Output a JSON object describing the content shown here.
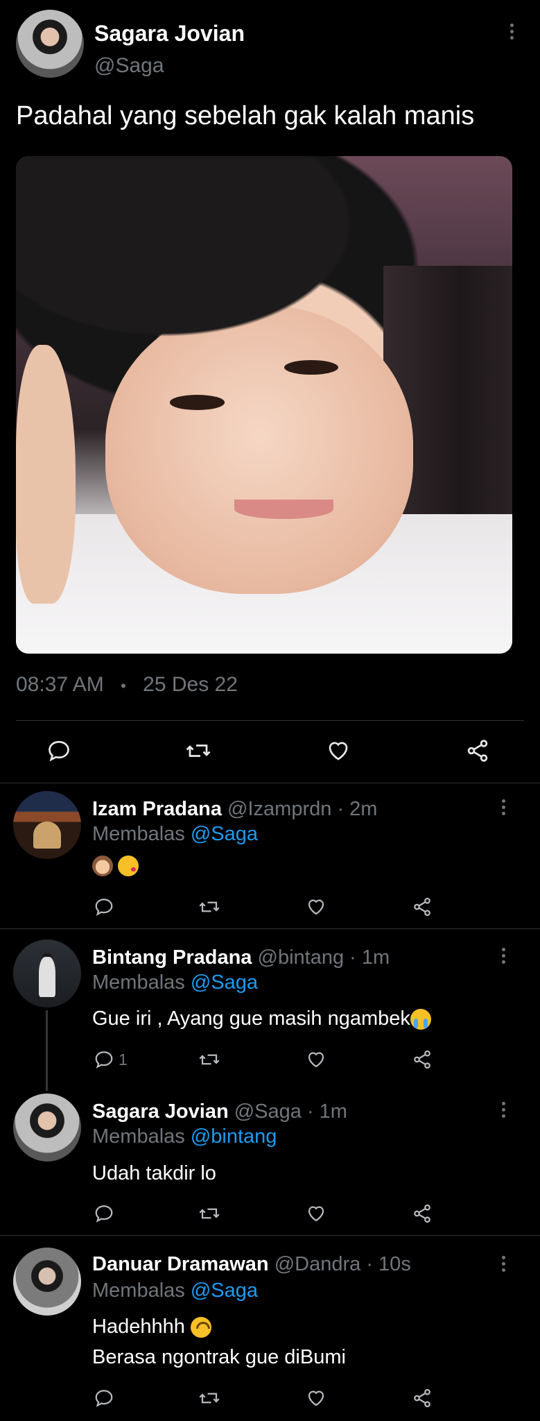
{
  "main_tweet": {
    "display_name": "Sagara Jovian",
    "handle": "@Saga",
    "text": "Padahal yang sebelah gak kalah manis",
    "time": "08:37 AM",
    "separator": "•",
    "date": "25 Des 22"
  },
  "replies": [
    {
      "display_name": "Izam Pradana",
      "handle": "@Izamprdn",
      "time": "· 2m",
      "reply_prefix": "Membalas",
      "reply_to": "@Saga",
      "text": "",
      "emojis": [
        "see-no-evil-monkey",
        "face-blowing-kiss"
      ],
      "reply_count": ""
    },
    {
      "display_name": "Bintang Pradana",
      "handle": "@bintang",
      "time": "· 1m",
      "reply_prefix": "Membalas",
      "reply_to": "@Saga",
      "text": "Gue iri , Ayang gue masih ngambek",
      "emojis": [
        "loudly-crying-face"
      ],
      "reply_count": "1"
    },
    {
      "display_name": "Sagara Jovian",
      "handle": "@Saga",
      "time": "· 1m",
      "reply_prefix": "Membalas",
      "reply_to": "@bintang",
      "text": "Udah takdir lo",
      "emojis": [],
      "reply_count": ""
    },
    {
      "display_name": "Danuar Dramawan",
      "handle": "@Dandra",
      "time": "· 10s",
      "reply_prefix": "Membalas",
      "reply_to": "@Saga",
      "text": "Hadehhhh",
      "text_line2": "Berasa ngontrak gue diBumi",
      "emojis": [
        "upside-down-face"
      ],
      "reply_count": ""
    }
  ],
  "icons": {
    "reply": "reply-icon",
    "retweet": "retweet-icon",
    "like": "like-icon",
    "share": "share-icon",
    "more": "more-vertical-icon"
  },
  "colors": {
    "background": "#000000",
    "text": "#e7e9ea",
    "muted": "#71767b",
    "link": "#1d9bf0",
    "divider": "#2f3336"
  }
}
